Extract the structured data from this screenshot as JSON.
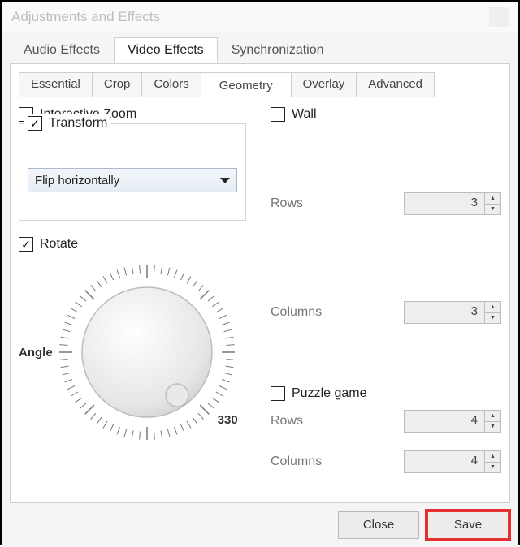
{
  "window": {
    "title": "Adjustments and Effects"
  },
  "tabs_main": {
    "audio": "Audio Effects",
    "video": "Video Effects",
    "sync": "Synchronization"
  },
  "tabs_sub": {
    "essential": "Essential",
    "crop": "Crop",
    "colors": "Colors",
    "geometry": "Geometry",
    "overlay": "Overlay",
    "advanced": "Advanced"
  },
  "geometry": {
    "interactive_zoom": {
      "label": "Interactive Zoom",
      "checked": false
    },
    "transform": {
      "label": "Transform",
      "checked": true,
      "value": "Flip horizontally"
    },
    "rotate": {
      "label": "Rotate",
      "checked": true,
      "angle_label": "Angle",
      "indicator": "330"
    },
    "wall": {
      "label": "Wall",
      "checked": false,
      "rows": {
        "label": "Rows",
        "value": "3"
      },
      "columns": {
        "label": "Columns",
        "value": "3"
      }
    },
    "puzzle": {
      "label": "Puzzle game",
      "checked": false,
      "rows": {
        "label": "Rows",
        "value": "4"
      },
      "columns": {
        "label": "Columns",
        "value": "4"
      }
    }
  },
  "footer": {
    "close": "Close",
    "save": "Save"
  }
}
